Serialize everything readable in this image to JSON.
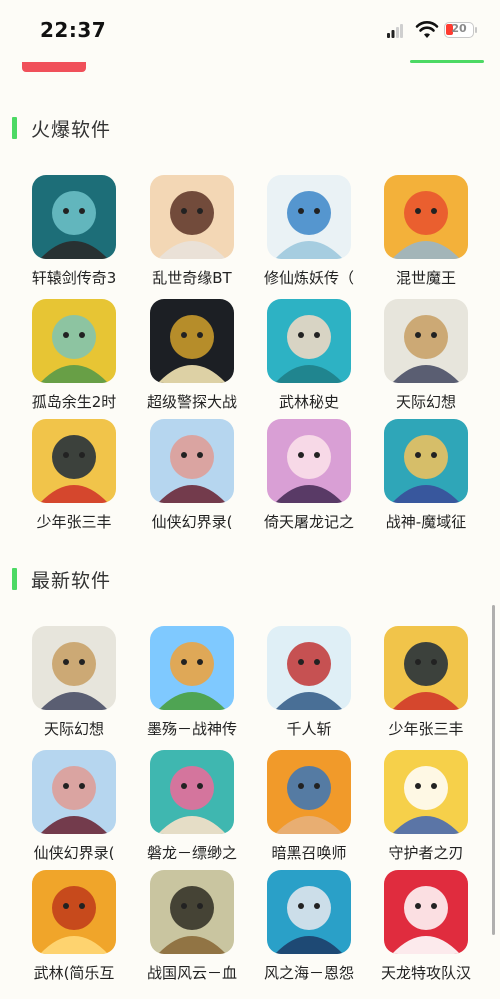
{
  "status_bar": {
    "time": "22:37",
    "battery": "20"
  },
  "sections": [
    {
      "title": "火爆软件",
      "apps": [
        {
          "label": "轩辕剑传奇3",
          "icon": "sword-game-icon",
          "colors": [
            "#1d6e78",
            "#6fc3c9",
            "#2a2a2a"
          ]
        },
        {
          "label": "乱世奇缘BT",
          "icon": "anime-boy-icon",
          "colors": [
            "#f3d7b5",
            "#5a3226",
            "#e9e2da"
          ]
        },
        {
          "label": "修仙炼妖传（",
          "icon": "calligraphy-icon",
          "colors": [
            "#eaf2f5",
            "#3b86c8",
            "#9fc9de"
          ]
        },
        {
          "label": "混世魔王",
          "icon": "monster-icon",
          "colors": [
            "#f3b13a",
            "#e8512e",
            "#9ab6c6"
          ]
        },
        {
          "label": "孤岛余生2时",
          "icon": "island-icon",
          "colors": [
            "#e7c534",
            "#7cc3b5",
            "#5a9a48"
          ]
        },
        {
          "label": "超级警探大战",
          "icon": "badge-icon",
          "colors": [
            "#1c1f24",
            "#d1a12c",
            "#f3e4b4"
          ]
        },
        {
          "label": "武林秘史",
          "icon": "wuxia-girl-icon",
          "colors": [
            "#2db2c4",
            "#f7d9c4",
            "#1f7f8a"
          ]
        },
        {
          "label": "天际幻想",
          "icon": "warrior-icon",
          "colors": [
            "#e7e5dc",
            "#c79f63",
            "#4a4f66"
          ]
        },
        {
          "label": "少年张三丰",
          "icon": "martial-arts-icon",
          "colors": [
            "#f1c44a",
            "#1c2a3a",
            "#d23a2a"
          ]
        },
        {
          "label": "仙侠幻界录(",
          "icon": "fairy-girl-icon",
          "colors": [
            "#b6d6ef",
            "#e09b93",
            "#6b2a3a"
          ]
        },
        {
          "label": "倚天屠龙记之",
          "icon": "anime-girl-icon",
          "colors": [
            "#d99fd5",
            "#fbe3ea",
            "#4a2f5a"
          ]
        },
        {
          "label": "战神-魔域征",
          "icon": "hero-icon",
          "colors": [
            "#2fa6b8",
            "#f3c25a",
            "#3a4f9a"
          ]
        }
      ]
    },
    {
      "title": "最新软件",
      "apps": [
        {
          "label": "天际幻想",
          "icon": "warrior-icon",
          "colors": [
            "#e7e5dc",
            "#c79f63",
            "#4a4f66"
          ]
        },
        {
          "label": "墨殇－战神传",
          "icon": "village-icon",
          "colors": [
            "#7fc9ff",
            "#f0a23a",
            "#4aa040"
          ]
        },
        {
          "label": "千人斩",
          "icon": "calligraphy-icon",
          "colors": [
            "#dfeff6",
            "#c23535",
            "#39618c"
          ]
        },
        {
          "label": "少年张三丰",
          "icon": "martial-arts-icon",
          "colors": [
            "#f1c44a",
            "#1c2a3a",
            "#d23a2a"
          ]
        },
        {
          "label": "仙侠幻界录(",
          "icon": "fairy-girl-icon",
          "colors": [
            "#b6d6ef",
            "#e09b93",
            "#6b2a3a"
          ]
        },
        {
          "label": "磐龙－缥缈之",
          "icon": "pink-hair-icon",
          "colors": [
            "#3fb7b0",
            "#ef6a9a",
            "#f7e1c9"
          ]
        },
        {
          "label": "暗黑召唤师",
          "icon": "summoner-icon",
          "colors": [
            "#f19a2a",
            "#3a75b8",
            "#e7b07a"
          ]
        },
        {
          "label": "守护者之刃",
          "icon": "blonde-hero-icon",
          "colors": [
            "#f6d04a",
            "#ffffff",
            "#4a6ab0"
          ]
        },
        {
          "label": "武林(简乐互",
          "icon": "wu-character-icon",
          "colors": [
            "#f0a52a",
            "#c03a1a",
            "#ffd877"
          ]
        },
        {
          "label": "战国风云－血",
          "icon": "general-icon",
          "colors": [
            "#c9c5a0",
            "#2e2b22",
            "#8b6a3a"
          ]
        },
        {
          "label": "风之海－恩怨",
          "icon": "silver-hair-icon",
          "colors": [
            "#2aa0c8",
            "#e9e9ee",
            "#1d3f6a"
          ]
        },
        {
          "label": "天龙特攻队汉",
          "icon": "letter-a-icon",
          "colors": [
            "#e02c3e",
            "#ffffff",
            "#ffffff"
          ]
        }
      ]
    }
  ]
}
